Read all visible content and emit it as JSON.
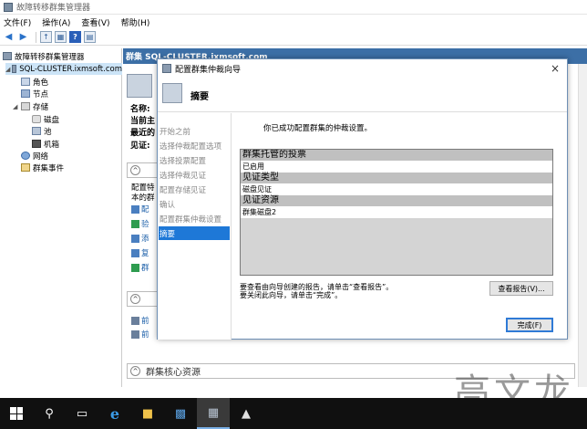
{
  "window": {
    "title": "故障转移群集管理器"
  },
  "menu": [
    "文件(F)",
    "操作(A)",
    "查看(V)",
    "帮助(H)"
  ],
  "tree": {
    "root": "故障转移群集管理器",
    "cluster": "SQL-CLUSTER.ixmsoft.com",
    "items": [
      {
        "label": "角色",
        "icon": "role-icon"
      },
      {
        "label": "节点",
        "icon": "node-icon"
      },
      {
        "label": "存储",
        "icon": "storage-icon"
      },
      {
        "label": "磁盘",
        "icon": "disk-icon"
      },
      {
        "label": "池",
        "icon": "pool-icon"
      },
      {
        "label": "机箱",
        "icon": "chassis-icon"
      },
      {
        "label": "网络",
        "icon": "network-icon"
      },
      {
        "label": "群集事件",
        "icon": "event-icon"
      }
    ]
  },
  "main": {
    "header": "群集 SQL-CLUSTER.ixmsoft.com",
    "fields": [
      "名称:",
      "当前主",
      "最近的",
      "见证:"
    ],
    "config_text_1": "配置特",
    "config_text_2": "本的群",
    "links": [
      "配",
      "验",
      "添",
      "复",
      "群"
    ],
    "lower_links": [
      "前",
      "前"
    ],
    "core_resources": "群集核心资源"
  },
  "dialog": {
    "title": "配置群集仲裁向导",
    "heading": "摘要",
    "close": "×",
    "steps": [
      "开始之前",
      "选择仲裁配置选项",
      "选择投票配置",
      "选择仲裁见证",
      "配置存储见证",
      "确认",
      "配置群集仲裁设置",
      "摘要"
    ],
    "active_step": 7,
    "intro": "你已成功配置群集的仲裁设置。",
    "report": [
      {
        "header": "群集托管的投票",
        "value": "已启用"
      },
      {
        "header": "见证类型",
        "value": "磁盘见证"
      },
      {
        "header": "见证资源",
        "value": "群集磁盘2"
      }
    ],
    "hint_1": "要查看由向导创建的报告，请单击“查看报告”。",
    "hint_2": "要关闭此向导，请单击“完成”。",
    "view_report": "查看报告(V)...",
    "finish": "完成(F)"
  },
  "watermark": "高文龙"
}
